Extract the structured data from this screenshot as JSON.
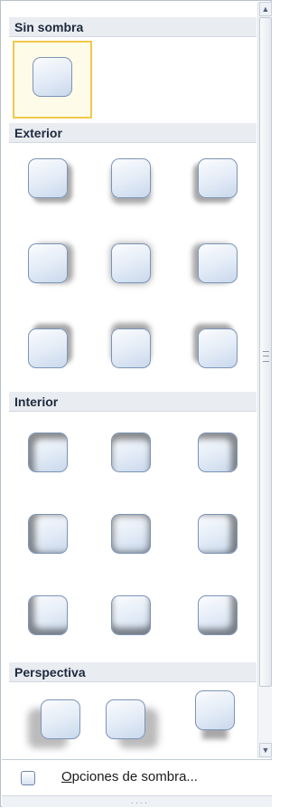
{
  "sections": {
    "none": {
      "title": "Sin sombra"
    },
    "outer": {
      "title": "Exterior"
    },
    "inner": {
      "title": "Interior"
    },
    "perspective": {
      "title": "Perspectiva"
    }
  },
  "footer": {
    "options_label_underlined": "O",
    "options_label_rest": "pciones de sombra..."
  },
  "colors": {
    "selection_border": "#f0c94a",
    "tile_border": "#7c94b6",
    "header_bg": "#e9ecf1"
  },
  "icons": [
    "scroll-up-icon",
    "scroll-down-icon",
    "scroll-grip-icon",
    "shadow-options-icon",
    "resize-grip-icon"
  ]
}
